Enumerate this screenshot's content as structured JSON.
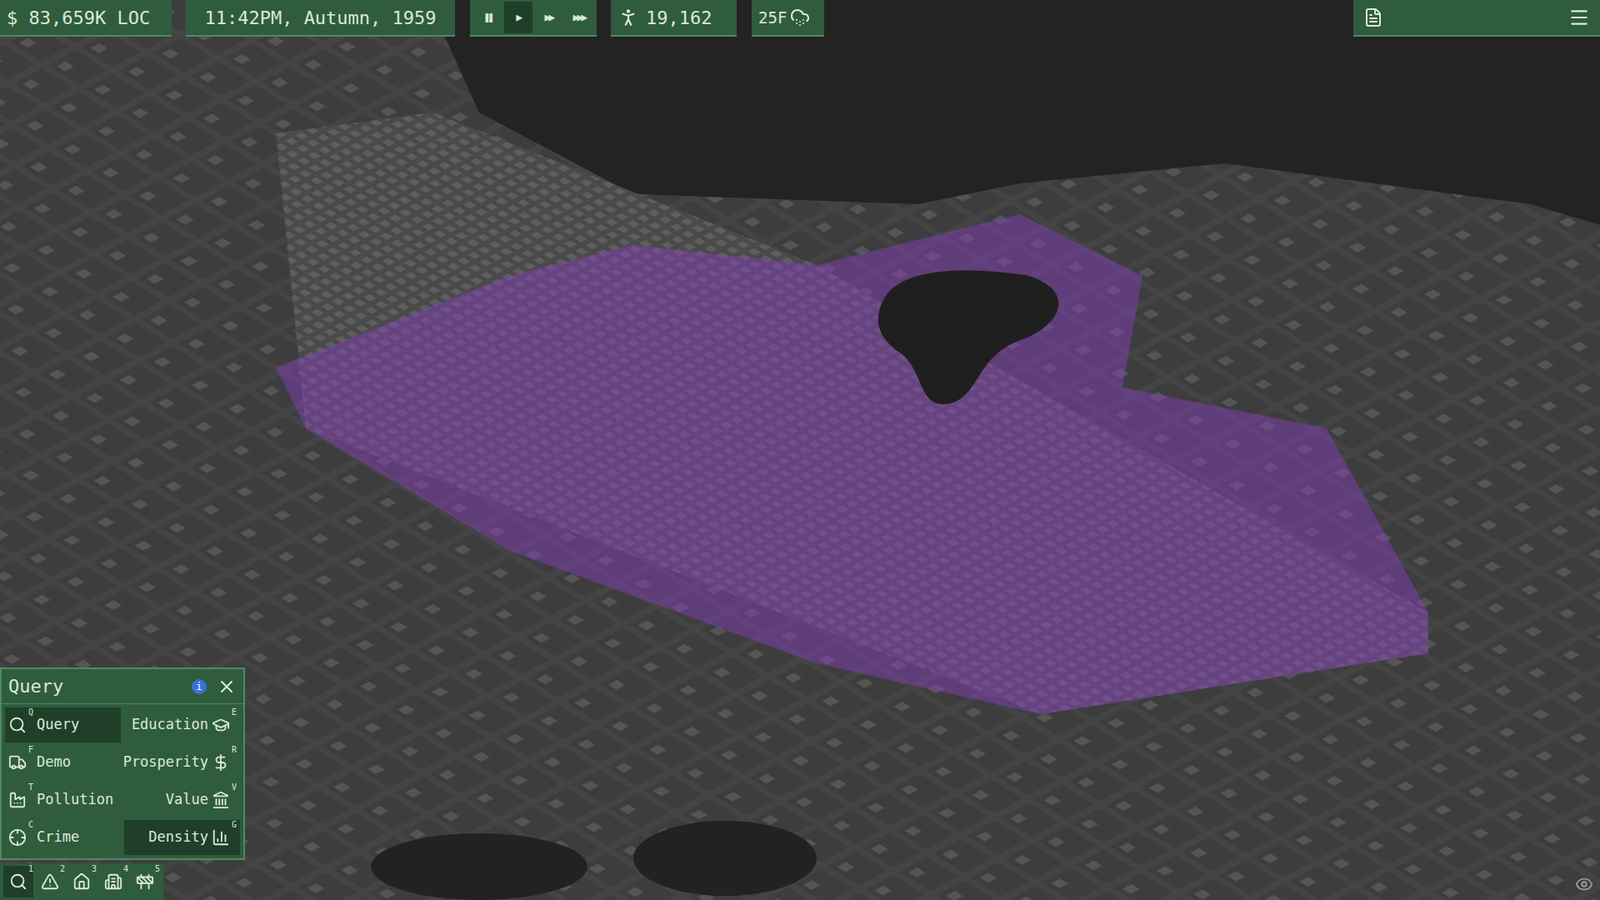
{
  "top_bar": {
    "money": "$ 83,659K LOC",
    "date": "11:42PM, Autumn, 1959",
    "speed_buttons": [
      {
        "label": "❚❚",
        "selected": false
      },
      {
        "label": "▶",
        "selected": true
      },
      {
        "label": "▶▶",
        "selected": false
      },
      {
        "label": "▶▶▶",
        "selected": false
      }
    ],
    "population": "19,162",
    "temperature": "25F"
  },
  "query_panel": {
    "title": "Query",
    "info": "i",
    "buttons": [
      {
        "label": "Query",
        "key": "Q",
        "selected": true
      },
      {
        "label": "Education",
        "key": "E",
        "selected": false
      },
      {
        "label": "Demo",
        "key": "F",
        "selected": false
      },
      {
        "label": "Prosperity",
        "key": "R",
        "selected": false
      },
      {
        "label": "Pollution",
        "key": "T",
        "selected": false
      },
      {
        "label": "Value",
        "key": "V",
        "selected": false
      },
      {
        "label": "Crime",
        "key": "C",
        "selected": false
      },
      {
        "label": "Density",
        "key": "G",
        "selected": true
      }
    ]
  },
  "toolbar": [
    {
      "key": "1",
      "selected": true
    },
    {
      "key": "2",
      "selected": false
    },
    {
      "key": "3",
      "selected": false
    },
    {
      "key": "4",
      "selected": false
    },
    {
      "key": "5",
      "selected": false
    }
  ]
}
